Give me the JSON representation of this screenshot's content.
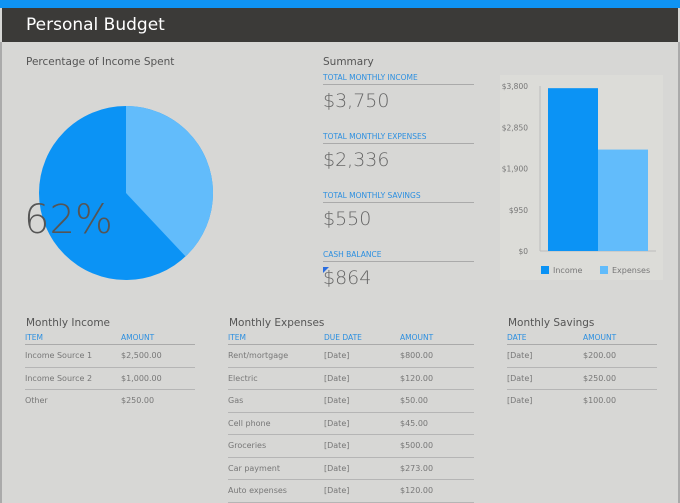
{
  "header": {
    "title": "Personal Budget"
  },
  "pie": {
    "title": "Percentage of Income Spent",
    "percent_label": "62%",
    "percent": 62,
    "colors": {
      "spent": "#0b93f5",
      "remaining": "#62bcfb"
    }
  },
  "summary": {
    "title": "Summary",
    "items": [
      {
        "label": "TOTAL MONTHLY INCOME",
        "value": "$3,750"
      },
      {
        "label": "TOTAL MONTHLY EXPENSES",
        "value": "$2,336"
      },
      {
        "label": "TOTAL MONTHLY SAVINGS",
        "value": "$550"
      },
      {
        "label": "CASH BALANCE",
        "value": "$864"
      }
    ]
  },
  "chart_data": {
    "type": "bar",
    "categories": [
      "Income",
      "Expenses"
    ],
    "values": [
      3750,
      2336
    ],
    "colors": [
      "#0b93f5",
      "#62bcfb"
    ],
    "yticks": [
      "$0",
      "$950",
      "$1,900",
      "$2,850",
      "$3,800"
    ],
    "ytick_values": [
      0,
      950,
      1900,
      2850,
      3800
    ],
    "ylim": [
      0,
      3800
    ],
    "legend": [
      "Income",
      "Expenses"
    ]
  },
  "income": {
    "title": "Monthly Income",
    "headers": [
      "ITEM",
      "AMOUNT"
    ],
    "rows": [
      [
        "Income Source 1",
        "$2,500.00"
      ],
      [
        "Income Source 2",
        "$1,000.00"
      ],
      [
        "Other",
        "$250.00"
      ]
    ]
  },
  "expenses": {
    "title": "Monthly Expenses",
    "headers": [
      "ITEM",
      "DUE DATE",
      "AMOUNT"
    ],
    "rows": [
      [
        "Rent/mortgage",
        "[Date]",
        "$800.00"
      ],
      [
        "Electric",
        "[Date]",
        "$120.00"
      ],
      [
        "Gas",
        "[Date]",
        "$50.00"
      ],
      [
        "Cell phone",
        "[Date]",
        "$45.00"
      ],
      [
        "Groceries",
        "[Date]",
        "$500.00"
      ],
      [
        "Car payment",
        "[Date]",
        "$273.00"
      ],
      [
        "Auto expenses",
        "[Date]",
        "$120.00"
      ]
    ]
  },
  "savings": {
    "title": "Monthly Savings",
    "headers": [
      "DATE",
      "AMOUNT"
    ],
    "rows": [
      [
        "[Date]",
        "$200.00"
      ],
      [
        "[Date]",
        "$250.00"
      ],
      [
        "[Date]",
        "$100.00"
      ]
    ]
  }
}
